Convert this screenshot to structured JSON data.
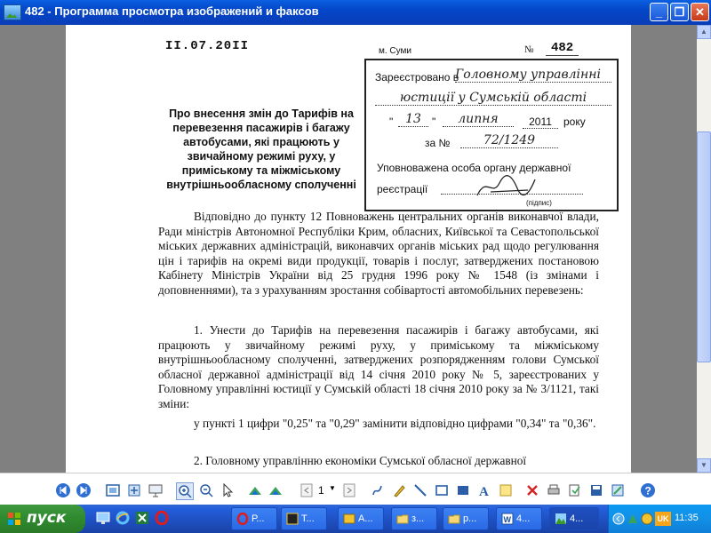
{
  "window": {
    "title": "482 - Программа просмотра изображений и факсов"
  },
  "document": {
    "date": "II.07.20II",
    "city": "м. Суми",
    "number_label": "№",
    "number": "482",
    "stamp": {
      "registered_prefix": "Зареєстровано в",
      "registered_hand_1": "Головному управлінні",
      "registered_hand_2": "юстиції у Сумській області",
      "day_quote_open": "\"",
      "day": "13",
      "day_quote_close": "\"",
      "month": "липня",
      "year": "2011",
      "year_suffix": "року",
      "reg_prefix": "за №",
      "reg_number": "72/1249",
      "authorized_line1": "Уповноважена особа органу державної",
      "authorized_line2": "реєстрації",
      "signature_caption": "(підпис)"
    },
    "subject": "Про внесення змін до Тарифів на перевезення пасажирів і багажу автобусами, які працюють у звичайному режимі руху, у приміському та міжміському внутрішньообласному сполученні",
    "para1": "Відповідно до пункту 12 Повноважень центральних органів виконавчої влади, Ради міністрів Автономної Республіки Крим, обласних, Київської та Севастопольської міських державних адміністрацій, виконавчих органів міських рад щодо регулювання цін і тарифів на окремі види продукції, товарів і послуг, затверджених постановою Кабінету Міністрів України від 25 грудня 1996 року № 1548 (із змінами і доповненнями), та з урахуванням зростання собівартості автомобільних перевезень:",
    "para2": "1. Унести до Тарифів на перевезення пасажирів і багажу автобусами, які працюють у звичайному режимі руху, у приміському та міжміському внутрішньообласному сполученні, затверджених розпорядженням голови Сумської обласної державної адміністрації від 14 січня 2010 року № 5, зареєстрованих у Головному управлінні юстиції у Сумській області 18 січня 2010 року за № 3/1121, такі зміни:",
    "para3": "у пункті 1 цифри \"0,25\" та \"0,29\" замінити відповідно цифрами \"0,34\" та \"0,36\".",
    "para4": "2. Головному управлінню економіки Сумської обласної державної"
  },
  "toolbar": {
    "page_number": "1"
  },
  "taskbar": {
    "start_label": "пуск",
    "tasks": [
      "Р...",
      "Т...",
      "А...",
      "з...",
      "р...",
      "4...",
      "4..."
    ],
    "language": "UK",
    "clock": "11:35"
  },
  "colors": {
    "titlebar": "#0a5fe0",
    "taskbar": "#245edb",
    "start": "#3f9a3f"
  }
}
